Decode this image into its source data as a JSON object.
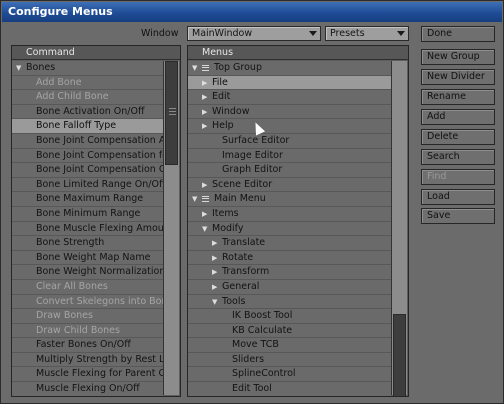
{
  "title": "Configure Menus",
  "window_label": "Window",
  "window_select": "MainWindow",
  "presets_select": "Presets",
  "command_header": "Command",
  "menus_header": "Menus",
  "commands": [
    {
      "text": "Bones",
      "dim": false,
      "expander": "open"
    },
    {
      "text": "Add Bone",
      "dim": true
    },
    {
      "text": "Add Child Bone",
      "dim": true
    },
    {
      "text": "Bone Activation On/Off",
      "dim": false
    },
    {
      "text": "Bone Falloff Type",
      "dim": false,
      "selected": true
    },
    {
      "text": "Bone Joint Compensation A...",
      "dim": false
    },
    {
      "text": "Bone Joint Compensation fo...",
      "dim": false
    },
    {
      "text": "Bone Joint Compensation O...",
      "dim": false
    },
    {
      "text": "Bone Limited Range On/Off",
      "dim": false
    },
    {
      "text": "Bone Maximum Range",
      "dim": false
    },
    {
      "text": "Bone Minimum Range",
      "dim": false
    },
    {
      "text": "Bone Muscle Flexing Amou",
      "dim": false
    },
    {
      "text": "Bone Strength",
      "dim": false
    },
    {
      "text": "Bone Weight Map Name",
      "dim": false
    },
    {
      "text": "Bone Weight Normalization",
      "dim": false
    },
    {
      "text": "Clear All Bones",
      "dim": true
    },
    {
      "text": "Convert Skelegons into Bone...",
      "dim": true
    },
    {
      "text": "Draw Bones",
      "dim": true
    },
    {
      "text": "Draw Child Bones",
      "dim": true
    },
    {
      "text": "Faster Bones On/Off",
      "dim": false
    },
    {
      "text": "Multiply Strength by Rest Le...",
      "dim": false
    },
    {
      "text": "Muscle Flexing for Parent O...",
      "dim": false
    },
    {
      "text": "Muscle Flexing On/Off",
      "dim": false
    }
  ],
  "menus": [
    {
      "text": "Top Group",
      "level": 0,
      "expander": "open",
      "group": true
    },
    {
      "text": "File",
      "level": 1,
      "expander": "closed",
      "selected": true
    },
    {
      "text": "Edit",
      "level": 1,
      "expander": "closed"
    },
    {
      "text": "Window",
      "level": 1,
      "expander": "closed"
    },
    {
      "text": "Help",
      "level": 1,
      "expander": "closed"
    },
    {
      "text": "Surface Editor",
      "level": 2
    },
    {
      "text": "Image Editor",
      "level": 2
    },
    {
      "text": "Graph Editor",
      "level": 2
    },
    {
      "text": "Scene Editor",
      "level": 1,
      "expander": "closed"
    },
    {
      "text": "Main Menu",
      "level": 0,
      "expander": "open",
      "group": true
    },
    {
      "text": "Items",
      "level": 1,
      "expander": "closed"
    },
    {
      "text": "Modify",
      "level": 1,
      "expander": "open"
    },
    {
      "text": "Translate",
      "level": 2,
      "expander": "closed"
    },
    {
      "text": "Rotate",
      "level": 2,
      "expander": "closed"
    },
    {
      "text": "Transform",
      "level": 2,
      "expander": "closed"
    },
    {
      "text": "General",
      "level": 2,
      "expander": "closed"
    },
    {
      "text": "Tools",
      "level": 2,
      "expander": "open"
    },
    {
      "text": "IK Boost Tool",
      "level": 3
    },
    {
      "text": "KB Calculate",
      "level": 3
    },
    {
      "text": "Move TCB",
      "level": 3
    },
    {
      "text": "Sliders",
      "level": 3
    },
    {
      "text": "SplineControl",
      "level": 3
    },
    {
      "text": "Edit Tool",
      "level": 3
    }
  ],
  "buttons": [
    {
      "label": "Done",
      "disabled": false
    },
    {
      "label": "New Group",
      "disabled": false
    },
    {
      "label": "New Divider",
      "disabled": false
    },
    {
      "label": "Rename",
      "disabled": false
    },
    {
      "label": "Add",
      "disabled": false
    },
    {
      "label": "Delete",
      "disabled": false
    },
    {
      "label": "Search",
      "disabled": false
    },
    {
      "label": "Find",
      "disabled": true
    },
    {
      "label": "Load",
      "disabled": false
    },
    {
      "label": "Save",
      "disabled": false
    }
  ],
  "icons": {
    "expander_open": "triangle-down-icon",
    "expander_closed": "triangle-right-icon",
    "group": "menu-group-icon",
    "cursor": "mouse-pointer-icon"
  },
  "colors": {
    "title_bar": "#1f4c96",
    "panel_bg": "#6a6a6a",
    "selected_row": "#9a9a9a",
    "dim_text": "#a5a5a5"
  }
}
